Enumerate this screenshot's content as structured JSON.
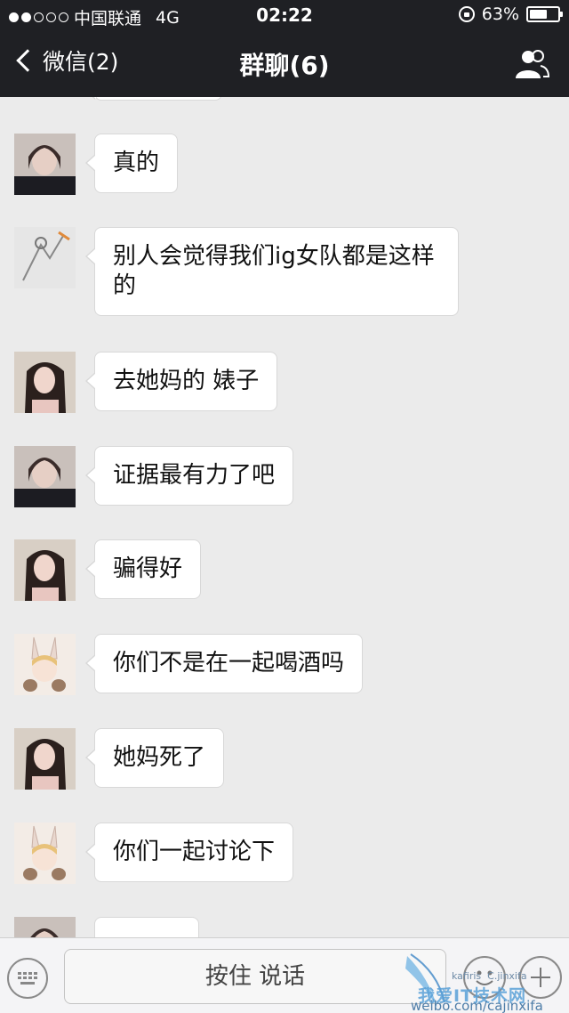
{
  "status": {
    "carrier": "中国联通",
    "network": "4G",
    "time": "02:22",
    "battery": "63%",
    "battery_level": 0.63,
    "signal_bars_filled": 2,
    "signal_bars_total": 5
  },
  "nav": {
    "back_label": "微信(2)",
    "title": "群聊(6)"
  },
  "messages": [
    {
      "avatar": "girl-black-hair-dark-top",
      "text": "真的"
    },
    {
      "avatar": "sketch-drawing",
      "text": "别人会觉得我们ig女队都是这样的"
    },
    {
      "avatar": "girl-long-hair-pink-top",
      "text": "去她妈的 婊子"
    },
    {
      "avatar": "girl-black-hair-dark-top",
      "text": "证据最有力了吧"
    },
    {
      "avatar": "girl-long-hair-pink-top",
      "text": "骗得好"
    },
    {
      "avatar": "anime-bunny-girl",
      "text": "你们不是在一起喝酒吗"
    },
    {
      "avatar": "girl-long-hair-pink-top",
      "text": "她妈死了"
    },
    {
      "avatar": "anime-bunny-girl",
      "text": "你们一起讨论下"
    }
  ],
  "input": {
    "hold_to_talk": "按住 说话"
  },
  "watermark": {
    "small": "kafiris   C.jinxifa",
    "big": "我爱IT技术网",
    "url": "weibo.com/cajinxifa"
  },
  "colors": {
    "topbar": "#1f2024",
    "chat_bg": "#ebebeb",
    "bubble": "#ffffff"
  }
}
